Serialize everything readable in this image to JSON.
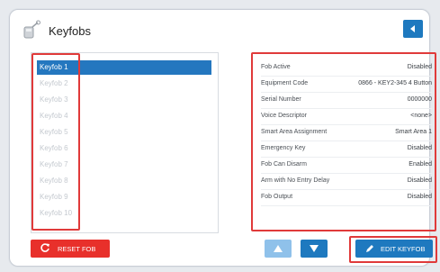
{
  "header": {
    "title": "Keyfobs"
  },
  "list": {
    "items": [
      "Keyfob 1",
      "Keyfob 2",
      "Keyfob 3",
      "Keyfob 4",
      "Keyfob 5",
      "Keyfob 6",
      "Keyfob 7",
      "Keyfob 8",
      "Keyfob 9",
      "Keyfob 10"
    ],
    "selected_index": 0
  },
  "details": [
    {
      "label": "Fob Active",
      "value": "Disabled"
    },
    {
      "label": "Equipment Code",
      "value": "0866 - KEY2-345 4 Button"
    },
    {
      "label": "Serial Number",
      "value": "0000000"
    },
    {
      "label": "Voice Descriptor",
      "value": "<none>"
    },
    {
      "label": "Smart Area Assignment",
      "value": "Smart Area 1"
    },
    {
      "label": "Emergency Key",
      "value": "Disabled"
    },
    {
      "label": "Fob Can Disarm",
      "value": "Enabled"
    },
    {
      "label": "Arm with No Entry Delay",
      "value": "Disabled"
    },
    {
      "label": "Fob Output",
      "value": "Disabled"
    }
  ],
  "buttons": {
    "reset": "RESET FOB",
    "edit": "EDIT KEYFOB"
  },
  "colors": {
    "primary": "#1e79bf",
    "danger": "#e8302b",
    "highlight": "#e03a3a"
  }
}
